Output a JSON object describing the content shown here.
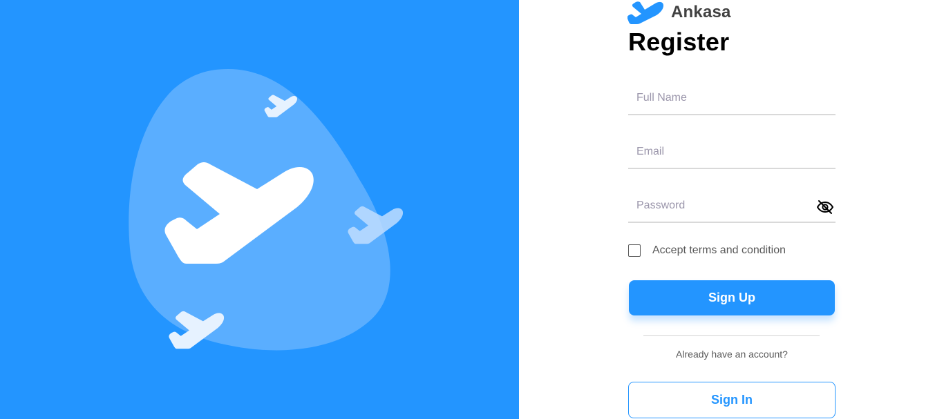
{
  "colors": {
    "primary": "#2395FF",
    "hero_bg": "#2395FF",
    "blob": "#5AAEFF",
    "text_dark": "#000000",
    "text_muted": "#595959",
    "placeholder": "#9B96AB"
  },
  "hero": {
    "illustration": "airplane-illustration"
  },
  "brand": {
    "name": "Ankasa",
    "logo_icon": "airplane-logo-icon"
  },
  "form": {
    "title": "Register",
    "full_name_placeholder": "Full Name",
    "email_placeholder": "Email",
    "password_placeholder": "Password",
    "password_toggle_icon": "eye-slash-icon",
    "terms_label": "Accept terms and condition",
    "terms_checked": false,
    "signup_label": "Sign Up",
    "already_text": "Already have an account?",
    "signin_label": "Sign In"
  }
}
